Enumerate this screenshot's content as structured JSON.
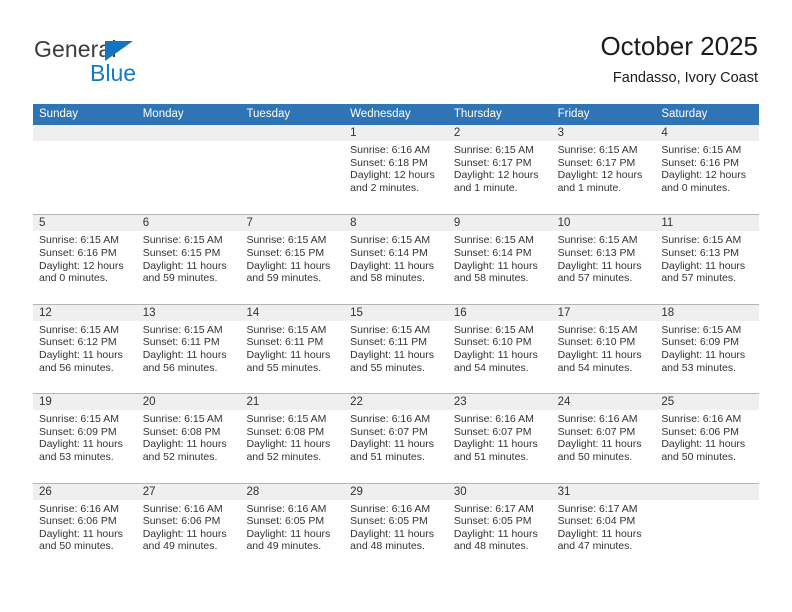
{
  "brand": {
    "name_top": "General",
    "name_bottom": "Blue",
    "triangle_color": "#1573c0",
    "text_top_color": "#3b3b3b",
    "text_bottom_color": "#1579cb"
  },
  "header": {
    "title": "October 2025",
    "subtitle": "Fandasso, Ivory Coast"
  },
  "theme": {
    "header_blue": "#2f74b5",
    "daynum_gray": "#efefef",
    "rule_gray": "#b6b6b6"
  },
  "weekdays": [
    "Sunday",
    "Monday",
    "Tuesday",
    "Wednesday",
    "Thursday",
    "Friday",
    "Saturday"
  ],
  "labels": {
    "sunrise_prefix": "Sunrise:",
    "sunset_prefix": "Sunset:",
    "daylight_prefix": "Daylight:"
  },
  "weeks": [
    [
      {
        "day": "",
        "lines": []
      },
      {
        "day": "",
        "lines": []
      },
      {
        "day": "",
        "lines": []
      },
      {
        "day": "1",
        "lines": [
          "Sunrise: 6:16 AM",
          "Sunset: 6:18 PM",
          "Daylight: 12 hours",
          "and 2 minutes."
        ]
      },
      {
        "day": "2",
        "lines": [
          "Sunrise: 6:15 AM",
          "Sunset: 6:17 PM",
          "Daylight: 12 hours",
          "and 1 minute."
        ]
      },
      {
        "day": "3",
        "lines": [
          "Sunrise: 6:15 AM",
          "Sunset: 6:17 PM",
          "Daylight: 12 hours",
          "and 1 minute."
        ]
      },
      {
        "day": "4",
        "lines": [
          "Sunrise: 6:15 AM",
          "Sunset: 6:16 PM",
          "Daylight: 12 hours",
          "and 0 minutes."
        ]
      }
    ],
    [
      {
        "day": "5",
        "lines": [
          "Sunrise: 6:15 AM",
          "Sunset: 6:16 PM",
          "Daylight: 12 hours",
          "and 0 minutes."
        ]
      },
      {
        "day": "6",
        "lines": [
          "Sunrise: 6:15 AM",
          "Sunset: 6:15 PM",
          "Daylight: 11 hours",
          "and 59 minutes."
        ]
      },
      {
        "day": "7",
        "lines": [
          "Sunrise: 6:15 AM",
          "Sunset: 6:15 PM",
          "Daylight: 11 hours",
          "and 59 minutes."
        ]
      },
      {
        "day": "8",
        "lines": [
          "Sunrise: 6:15 AM",
          "Sunset: 6:14 PM",
          "Daylight: 11 hours",
          "and 58 minutes."
        ]
      },
      {
        "day": "9",
        "lines": [
          "Sunrise: 6:15 AM",
          "Sunset: 6:14 PM",
          "Daylight: 11 hours",
          "and 58 minutes."
        ]
      },
      {
        "day": "10",
        "lines": [
          "Sunrise: 6:15 AM",
          "Sunset: 6:13 PM",
          "Daylight: 11 hours",
          "and 57 minutes."
        ]
      },
      {
        "day": "11",
        "lines": [
          "Sunrise: 6:15 AM",
          "Sunset: 6:13 PM",
          "Daylight: 11 hours",
          "and 57 minutes."
        ]
      }
    ],
    [
      {
        "day": "12",
        "lines": [
          "Sunrise: 6:15 AM",
          "Sunset: 6:12 PM",
          "Daylight: 11 hours",
          "and 56 minutes."
        ]
      },
      {
        "day": "13",
        "lines": [
          "Sunrise: 6:15 AM",
          "Sunset: 6:11 PM",
          "Daylight: 11 hours",
          "and 56 minutes."
        ]
      },
      {
        "day": "14",
        "lines": [
          "Sunrise: 6:15 AM",
          "Sunset: 6:11 PM",
          "Daylight: 11 hours",
          "and 55 minutes."
        ]
      },
      {
        "day": "15",
        "lines": [
          "Sunrise: 6:15 AM",
          "Sunset: 6:11 PM",
          "Daylight: 11 hours",
          "and 55 minutes."
        ]
      },
      {
        "day": "16",
        "lines": [
          "Sunrise: 6:15 AM",
          "Sunset: 6:10 PM",
          "Daylight: 11 hours",
          "and 54 minutes."
        ]
      },
      {
        "day": "17",
        "lines": [
          "Sunrise: 6:15 AM",
          "Sunset: 6:10 PM",
          "Daylight: 11 hours",
          "and 54 minutes."
        ]
      },
      {
        "day": "18",
        "lines": [
          "Sunrise: 6:15 AM",
          "Sunset: 6:09 PM",
          "Daylight: 11 hours",
          "and 53 minutes."
        ]
      }
    ],
    [
      {
        "day": "19",
        "lines": [
          "Sunrise: 6:15 AM",
          "Sunset: 6:09 PM",
          "Daylight: 11 hours",
          "and 53 minutes."
        ]
      },
      {
        "day": "20",
        "lines": [
          "Sunrise: 6:15 AM",
          "Sunset: 6:08 PM",
          "Daylight: 11 hours",
          "and 52 minutes."
        ]
      },
      {
        "day": "21",
        "lines": [
          "Sunrise: 6:15 AM",
          "Sunset: 6:08 PM",
          "Daylight: 11 hours",
          "and 52 minutes."
        ]
      },
      {
        "day": "22",
        "lines": [
          "Sunrise: 6:16 AM",
          "Sunset: 6:07 PM",
          "Daylight: 11 hours",
          "and 51 minutes."
        ]
      },
      {
        "day": "23",
        "lines": [
          "Sunrise: 6:16 AM",
          "Sunset: 6:07 PM",
          "Daylight: 11 hours",
          "and 51 minutes."
        ]
      },
      {
        "day": "24",
        "lines": [
          "Sunrise: 6:16 AM",
          "Sunset: 6:07 PM",
          "Daylight: 11 hours",
          "and 50 minutes."
        ]
      },
      {
        "day": "25",
        "lines": [
          "Sunrise: 6:16 AM",
          "Sunset: 6:06 PM",
          "Daylight: 11 hours",
          "and 50 minutes."
        ]
      }
    ],
    [
      {
        "day": "26",
        "lines": [
          "Sunrise: 6:16 AM",
          "Sunset: 6:06 PM",
          "Daylight: 11 hours",
          "and 50 minutes."
        ]
      },
      {
        "day": "27",
        "lines": [
          "Sunrise: 6:16 AM",
          "Sunset: 6:06 PM",
          "Daylight: 11 hours",
          "and 49 minutes."
        ]
      },
      {
        "day": "28",
        "lines": [
          "Sunrise: 6:16 AM",
          "Sunset: 6:05 PM",
          "Daylight: 11 hours",
          "and 49 minutes."
        ]
      },
      {
        "day": "29",
        "lines": [
          "Sunrise: 6:16 AM",
          "Sunset: 6:05 PM",
          "Daylight: 11 hours",
          "and 48 minutes."
        ]
      },
      {
        "day": "30",
        "lines": [
          "Sunrise: 6:17 AM",
          "Sunset: 6:05 PM",
          "Daylight: 11 hours",
          "and 48 minutes."
        ]
      },
      {
        "day": "31",
        "lines": [
          "Sunrise: 6:17 AM",
          "Sunset: 6:04 PM",
          "Daylight: 11 hours",
          "and 47 minutes."
        ]
      },
      {
        "day": "",
        "lines": []
      }
    ]
  ]
}
